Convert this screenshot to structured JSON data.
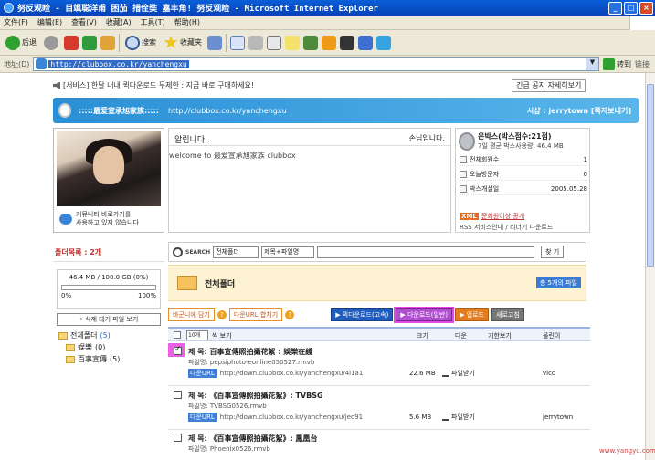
{
  "window": {
    "title": "努反观睑 - 目飒聪洋甫 困茄 措佺奘 嘉丰角! 努反观睑 - Microsoft Internet Explorer",
    "buttons": {
      "minimize": "_",
      "maximize": "□",
      "close": "×"
    }
  },
  "menu": [
    "文件(F)",
    "编辑(E)",
    "查看(V)",
    "收藏(A)",
    "工具(T)",
    "帮助(H)"
  ],
  "toolbar": {
    "back": "后退",
    "search": "搜索",
    "favorites": "收藏夹"
  },
  "address": {
    "label": "地址(D)",
    "url": "http://clubbox.co.kr/yanchengxu",
    "go": "转到",
    "links": "链接",
    "dropdown": "▼"
  },
  "notice": {
    "text": "[서비스] 한달 내내 퀵다운로드 무제한 : 지금 바로 구매하세요!",
    "button": "긴급 공지 자세히보기"
  },
  "banner": {
    "name": ":::::最爱宣承旭家族:::::",
    "url": "http://clubbox.co.kr/yanchengxu",
    "operator": "시샵 : jerrytown [쪽지보내기]"
  },
  "profile": {
    "community": "커뮤니티 바로가기를\n사용하고 있지 않습니다"
  },
  "board": {
    "heading": "알립니다.",
    "greeting": "손님입니다.",
    "welcome": "welcome to 最爱宣承旭家族 clubbox"
  },
  "silver": {
    "title": "은박스(박스점수:21점)",
    "subtitle": "7일 평균 박스사용량: 46.4 MB",
    "rows": [
      {
        "label": "전체회원수",
        "value": "1"
      },
      {
        "label": "오늘방문자",
        "value": "0"
      },
      {
        "label": "박스개설일",
        "value": "2005.05.28"
      }
    ],
    "xml_tag": "XML",
    "xml_link": "준회원이상 공개",
    "rss": "RSS 서비스안내 / 리더기 다운로드"
  },
  "folders": {
    "header": "폴더목록 : 2개",
    "capacity": "46.4 MB / 100.0 GB (0%)",
    "cap_start": "0%",
    "cap_end": "100%",
    "delete_btn": "• 삭제 대기 파일 보기",
    "tree": [
      {
        "name": "전체폴더",
        "count": "(5)"
      },
      {
        "name": "娱樂",
        "count": "(0)"
      },
      {
        "name": "百事宣傳",
        "count": "(5)"
      }
    ]
  },
  "search": {
    "label": "SEARCH",
    "folder_select": "전체폴더",
    "field_select": "제목+파일명",
    "button": "찾 기"
  },
  "folder_head": {
    "title": "전체폴더",
    "count": "총 5개의 파일"
  },
  "actions": {
    "copy_my": "바군니에 담기",
    "q": "?",
    "download_url": "다운URL 합치기",
    "quick_download": "▶ 퀵다운로드(고속)",
    "download_normal": "▶ 다운로드(일반)",
    "upload": "▶ 업로드",
    "refresh": "새로고침"
  },
  "list": {
    "per_page": "10개",
    "per_page_label": "씩 보기",
    "cols": [
      "크기",
      "다운",
      "기한보기",
      "올린이"
    ],
    "items": [
      {
        "title": "제  목: 百事宣傳照拍攝花絮 : 娛樂在綫",
        "file": "파일명: pepsiphoto-eonline050527.rmvb",
        "url_tag": "다운URL",
        "url": "http://down.clubbox.co.kr/yanchengxu/4l1a1",
        "size": "22.6 MB",
        "download": "파일받기",
        "uploader": "vicc",
        "checked": true
      },
      {
        "title": "제  목: 《百事宣傳照拍攝花絮》: TVBSG",
        "file": "파일명: TVBSG0526.rmvb",
        "url_tag": "다운URL",
        "url": "http://down.clubbox.co.kr/yanchengxu/jeo91",
        "size": "5.6 MB",
        "download": "파일받기",
        "uploader": "jerrytown",
        "checked": false
      },
      {
        "title": "제  목: 《百事宣傳照拍攝花絮》: 鳳凰台",
        "file": "파일명: Phoenix0526.rmvb",
        "checked": false
      }
    ]
  },
  "watermark": "www.yangyu.com",
  "colors": {
    "accent": "#2a8fd6",
    "highlight": "#ec5fe8",
    "xp_title": "#0a5fd8"
  }
}
